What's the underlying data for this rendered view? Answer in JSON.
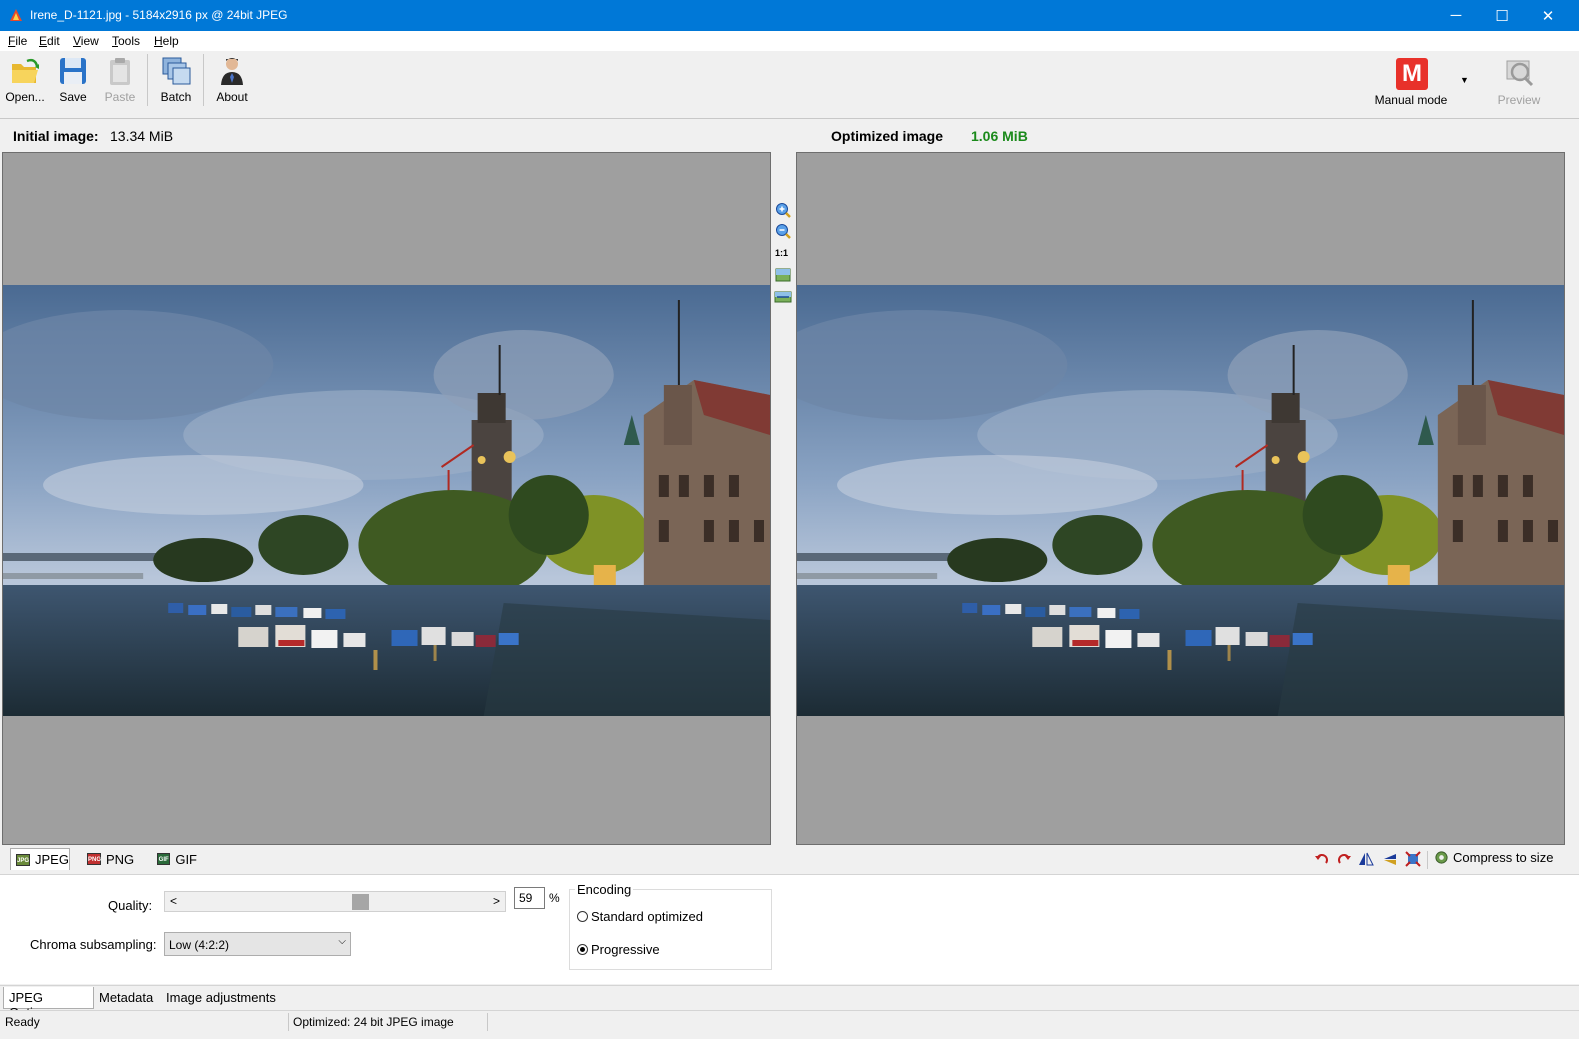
{
  "window": {
    "title": "Irene_D-1121.jpg - 5184x2916 px @ 24bit JPEG",
    "minimize": "─",
    "maximize": "☐",
    "close": "✕"
  },
  "menu": [
    "File",
    "Edit",
    "View",
    "Tools",
    "Help"
  ],
  "toolbar": {
    "open": "Open...",
    "save": "Save",
    "paste": "Paste",
    "batch": "Batch",
    "about": "About",
    "mode_letter": "M",
    "mode": "Manual mode",
    "preview": "Preview"
  },
  "initial": {
    "label": "Initial image:",
    "size": "13.34 MiB"
  },
  "optimized": {
    "label": "Optimized image",
    "size": "1.06 MiB"
  },
  "zoom": {
    "one_to_one": "1:1"
  },
  "formats": {
    "jpeg": "JPEG",
    "png": "PNG",
    "gif": "GIF",
    "compress": "Compress to size"
  },
  "options": {
    "quality_label": "Quality:",
    "quality_value": "59",
    "quality_fraction": 0.59,
    "percent": "%",
    "chroma_label": "Chroma subsampling:",
    "chroma_value": "Low (4:2:2)",
    "encoding_title": "Encoding",
    "standard": "Standard optimized",
    "progressive": "Progressive",
    "selected": "Progressive"
  },
  "tabs": [
    "JPEG Options",
    "Metadata",
    "Image adjustments"
  ],
  "status": {
    "left": "Ready",
    "right": "Optimized: 24 bit JPEG image"
  },
  "colors": {
    "accent": "#0078d7",
    "optimized_size": "#1a8a1a",
    "mode_badge": "#e8312a"
  }
}
